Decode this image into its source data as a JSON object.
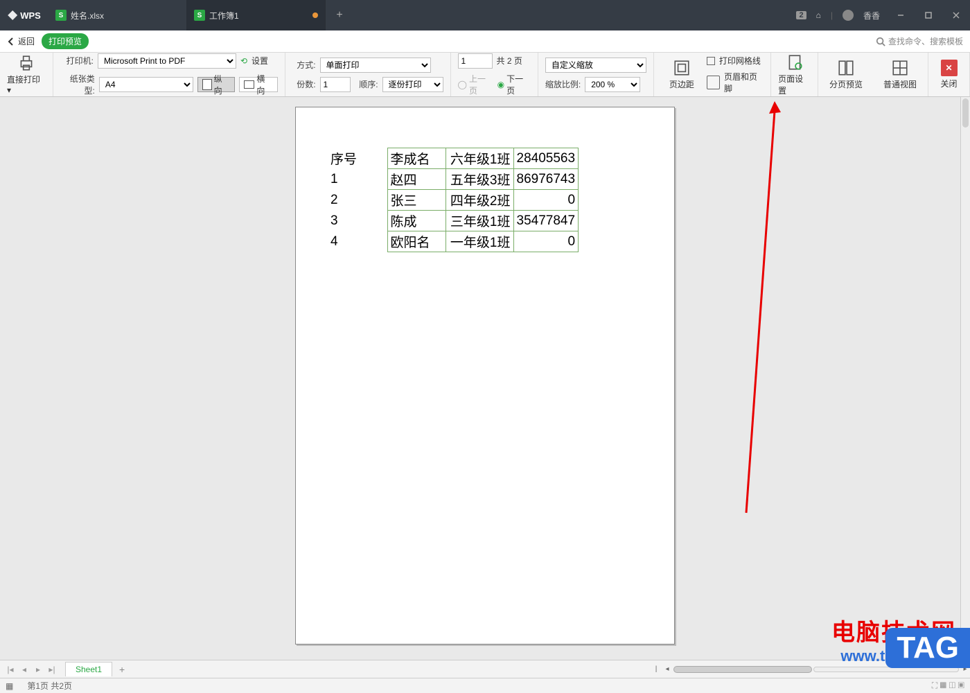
{
  "titlebar": {
    "wps": "WPS",
    "tabs": [
      {
        "label": "姓名.xlsx",
        "active": false,
        "dirty": false
      },
      {
        "label": "工作簿1",
        "active": true,
        "dirty": true
      }
    ],
    "badge": "2",
    "username": "香香"
  },
  "subhead": {
    "back": "返回",
    "preview_pill": "打印预览",
    "search_hint": "查找命令、搜索模板"
  },
  "ribbon": {
    "direct_print": "直接打印",
    "printer_label": "打印机:",
    "printer_value": "Microsoft Print to PDF",
    "settings": "设置",
    "paper_label": "纸张类型:",
    "paper_value": "A4",
    "portrait": "纵向",
    "landscape": "横向",
    "mode_label": "方式:",
    "mode_value": "单面打印",
    "copies_label": "份数:",
    "copies_value": "1",
    "order_label": "顺序:",
    "order_value": "逐份打印",
    "page_value": "1",
    "page_total": "共 2 页",
    "prev": "上一页",
    "next": "下一页",
    "zoom_mode": "自定义缩放",
    "zoom_label": "缩放比例:",
    "zoom_value": "200 %",
    "margins": "页边距",
    "gridlines": "打印网格线",
    "header_footer": "页眉和页脚",
    "page_setup": "页面设置",
    "paged_view": "分页预览",
    "normal_view": "普通视图",
    "close": "关闭"
  },
  "table": {
    "seq_header": "序号",
    "rows": [
      {
        "seq": "",
        "name": "李成名",
        "class": "六年级1班",
        "num": "28405563"
      },
      {
        "seq": "1",
        "name": "赵四",
        "class": "五年级3班",
        "num": "86976743"
      },
      {
        "seq": "2",
        "name": "张三",
        "class": "四年级2班",
        "num": "0"
      },
      {
        "seq": "3",
        "name": "陈成",
        "class": "三年级1班",
        "num": "35477847"
      },
      {
        "seq": "4",
        "name": "欧阳名",
        "class": "一年级1班",
        "num": "0"
      }
    ]
  },
  "sheetbar": {
    "sheet_name": "Sheet1"
  },
  "status": {
    "page_info": "第1页 共2页"
  },
  "watermark": {
    "title": "电脑技术网",
    "url": "www.tagxp.com",
    "tag": "TAG"
  }
}
